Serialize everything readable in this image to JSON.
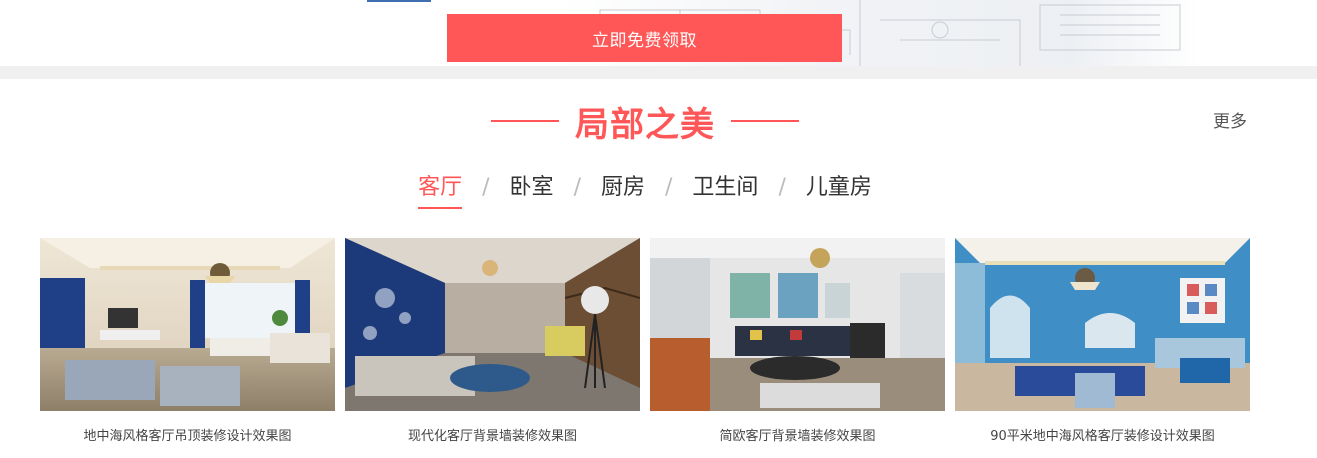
{
  "banner": {
    "cta_label": "立即免费领取"
  },
  "section": {
    "title": "局部之美",
    "more_label": "更多"
  },
  "tabs": [
    {
      "label": "客厅",
      "active": true
    },
    {
      "label": "卧室",
      "active": false
    },
    {
      "label": "厨房",
      "active": false
    },
    {
      "label": "卫生间",
      "active": false
    },
    {
      "label": "儿童房",
      "active": false
    }
  ],
  "tab_separator": "/",
  "gallery": [
    {
      "caption": "地中海风格客厅吊顶装修设计效果图"
    },
    {
      "caption": "现代化客厅背景墙装修效果图"
    },
    {
      "caption": "简欧客厅背景墙装修效果图"
    },
    {
      "caption": "90平米地中海风格客厅装修设计效果图"
    }
  ],
  "colors": {
    "accent": "#ff5757",
    "band": "#f0f0f0",
    "text": "#333333"
  }
}
